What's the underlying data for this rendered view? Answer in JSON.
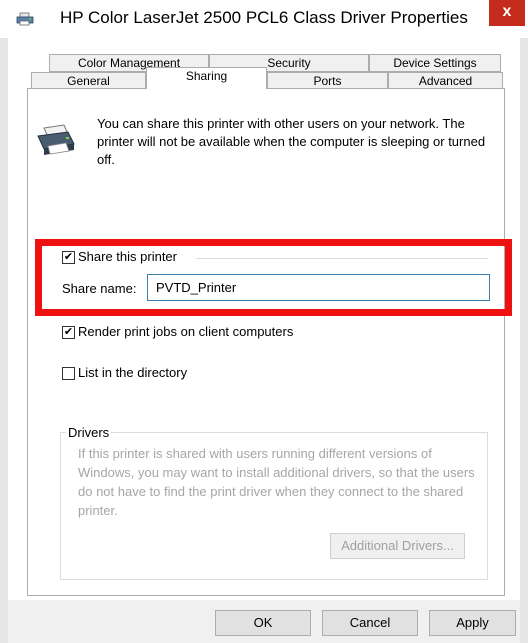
{
  "window": {
    "title": "HP Color LaserJet 2500 PCL6 Class Driver Properties",
    "close_glyph": "x"
  },
  "tabs": {
    "row1": [
      "Color Management",
      "Security",
      "Device Settings"
    ],
    "row2": [
      "General",
      "Sharing",
      "Ports",
      "Advanced"
    ],
    "active": "Sharing"
  },
  "sharing": {
    "intro": "You can share this printer with other users on your network. The printer will not be available when the computer is sleeping or turned off.",
    "share_printer": {
      "label": "Share this printer",
      "checked": true
    },
    "share_name": {
      "label": "Share name:",
      "value": "PVTD_Printer"
    },
    "render_jobs": {
      "label": "Render print jobs on client computers",
      "checked": true
    },
    "list_directory": {
      "label": "List in the directory",
      "checked": false
    },
    "drivers": {
      "title": "Drivers",
      "text": "If this printer is shared with users running different versions of Windows, you may want to install additional drivers, so that the users do not have to find the print driver when they connect to the shared printer.",
      "button": "Additional Drivers..."
    }
  },
  "buttons": {
    "ok": "OK",
    "cancel": "Cancel",
    "apply": "Apply"
  },
  "colors": {
    "highlight": "#ee1111",
    "close": "#c42b1c",
    "disabled_text": "#a6a6a6"
  },
  "icons": {
    "title": "printer-icon",
    "panel": "printer-icon"
  }
}
